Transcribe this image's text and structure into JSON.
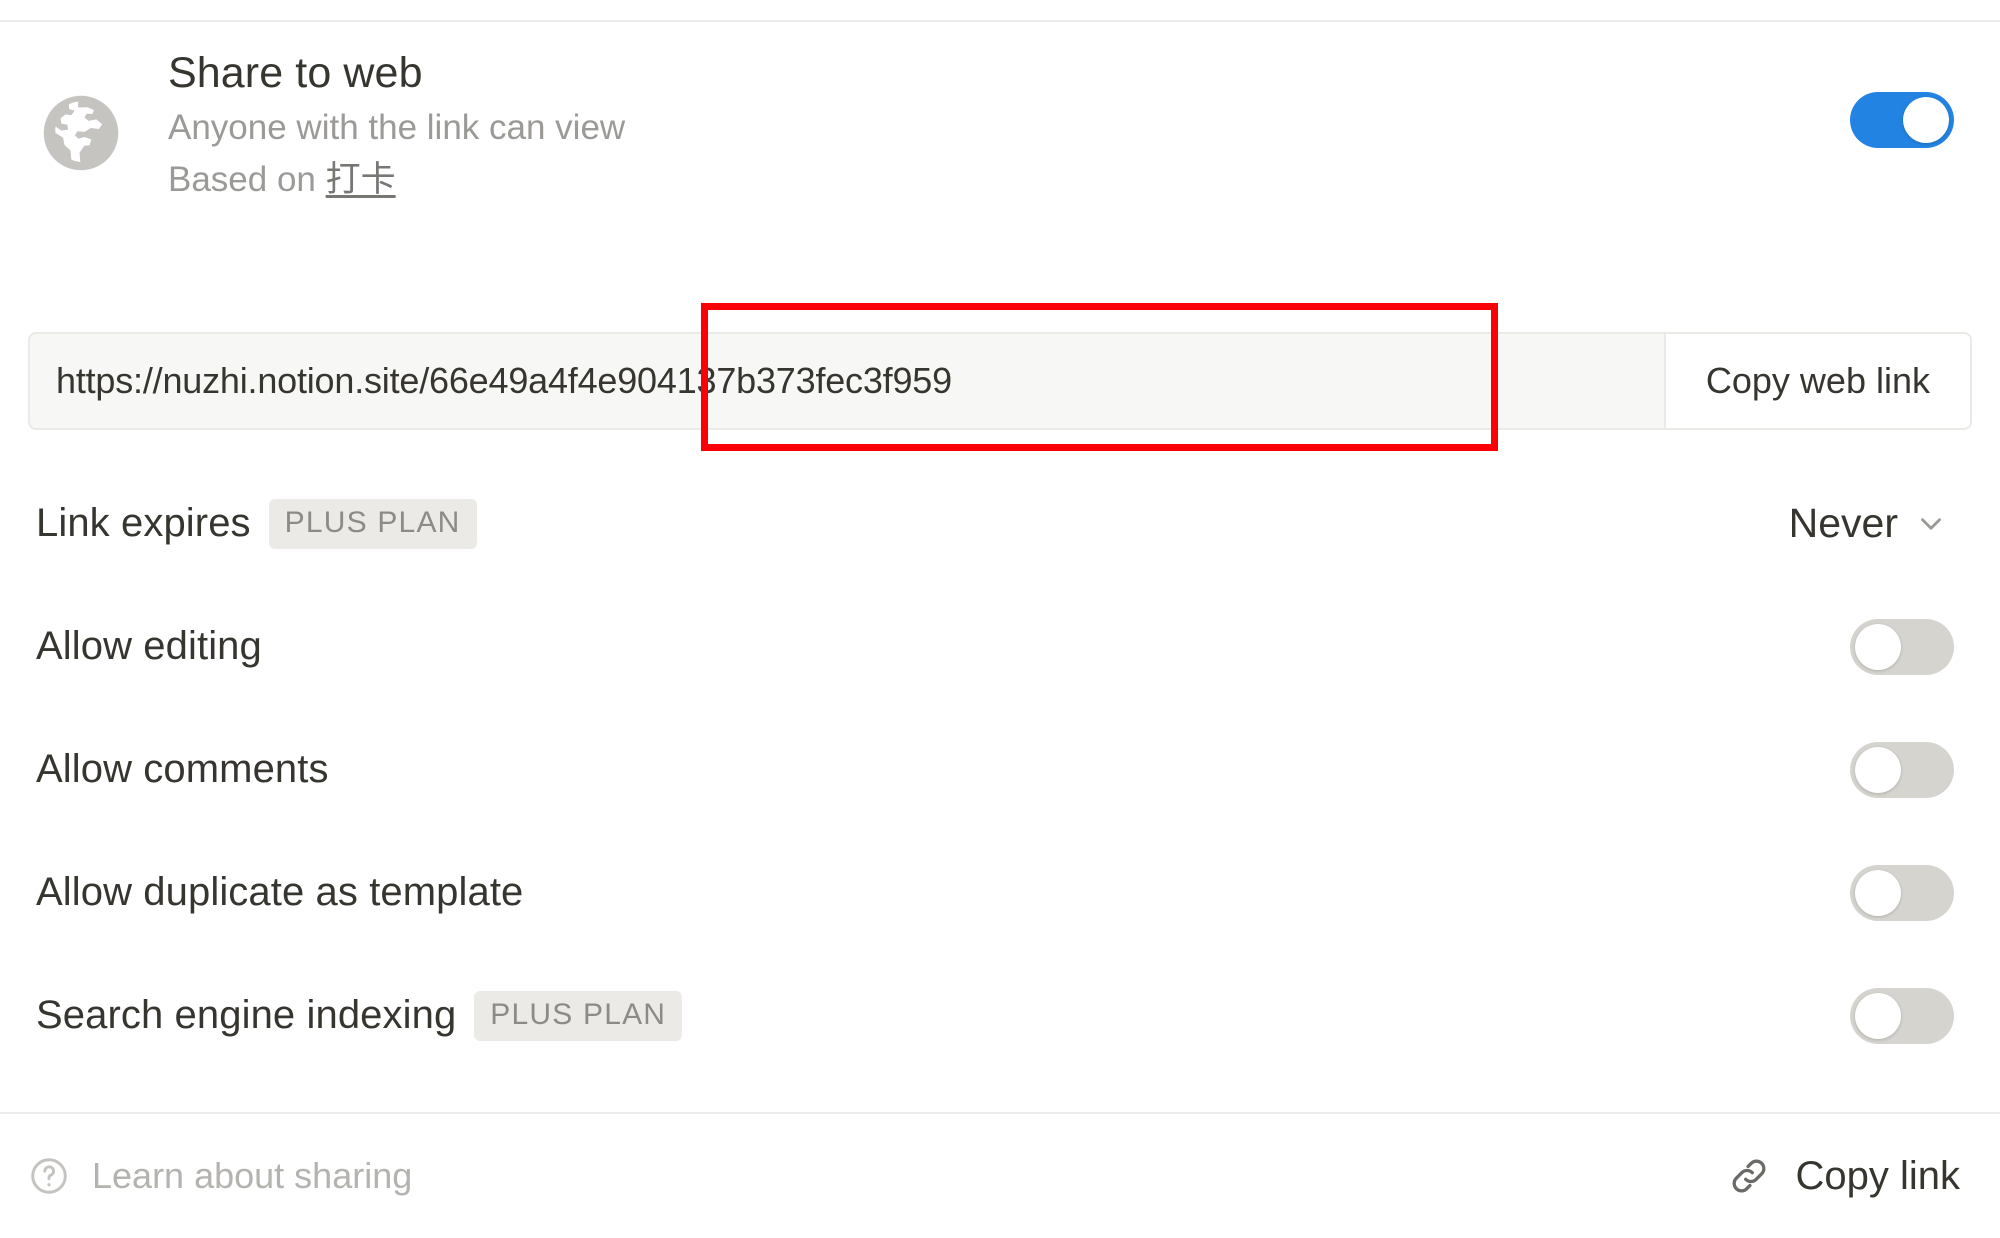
{
  "header": {
    "icon": "globe-icon",
    "title": "Share to web",
    "subtitle": "Anyone with the link can view",
    "based_on_prefix": "Based on ",
    "based_on_source": "打卡",
    "toggle_on": true
  },
  "url_row": {
    "url": "https://nuzhi.notion.site/66e49a4f4e904137b373fec3f959",
    "copy_web_link_label": "Copy web link"
  },
  "annotation": {
    "color": "#fb0007",
    "target": "url-id-segment"
  },
  "settings": [
    {
      "name": "link-expires",
      "label": "Link expires",
      "badge": "PLUS PLAN",
      "control": "select",
      "value": "Never"
    },
    {
      "name": "allow-editing",
      "label": "Allow editing",
      "badge": null,
      "control": "toggle",
      "value": false
    },
    {
      "name": "allow-comments",
      "label": "Allow comments",
      "badge": null,
      "control": "toggle",
      "value": false
    },
    {
      "name": "allow-duplicate-as-template",
      "label": "Allow duplicate as template",
      "badge": null,
      "control": "toggle",
      "value": false
    },
    {
      "name": "search-engine-indexing",
      "label": "Search engine indexing",
      "badge": "PLUS PLAN",
      "control": "toggle",
      "value": false
    }
  ],
  "footer": {
    "help_icon": "question-circle-icon",
    "learn_label": "Learn about sharing",
    "link_icon": "chain-link-icon",
    "copy_link_label": "Copy link"
  },
  "colors": {
    "accent_blue": "#2383e2",
    "toggle_off": "#d6d4cf",
    "text_primary": "#37352f",
    "text_muted": "#9b9a97",
    "badge_bg": "#eceae6",
    "annotation_red": "#fb0007"
  }
}
